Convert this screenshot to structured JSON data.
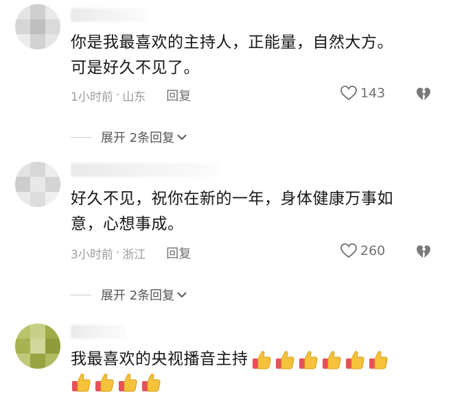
{
  "comments": [
    {
      "text_lines": [
        "你是我最喜欢的主持人，正能量，自然大方。",
        "可是好久不见了。"
      ],
      "time": "1小时前",
      "separator": "·",
      "location": "山东",
      "reply_label": "回复",
      "likes": "143",
      "expand_label": "展开 2条回复"
    },
    {
      "text_lines": [
        "好久不见，祝你在新的一年，身体健康万事如",
        "意，心想事成。"
      ],
      "time": "3小时前",
      "separator": "·",
      "location": "浙江",
      "reply_label": "回复",
      "likes": "260",
      "expand_label": "展开 2条回复"
    },
    {
      "text_lines": [
        "我最喜欢的央视播音主持"
      ],
      "thumbs_after_line1": 6,
      "thumbs_line2": 4
    }
  ],
  "colors": {
    "thumb_fill": "#f5c33b",
    "sleeve_fill": "#e8505b",
    "meta_text": "#9b9b9b",
    "icon_stroke": "#6f6f6f"
  },
  "icons": {
    "like": "heart-outline-icon",
    "dislike": "broken-heart-icon",
    "expand": "chevron-down-icon",
    "emoji": "thumbs-up-emoji-icon"
  }
}
